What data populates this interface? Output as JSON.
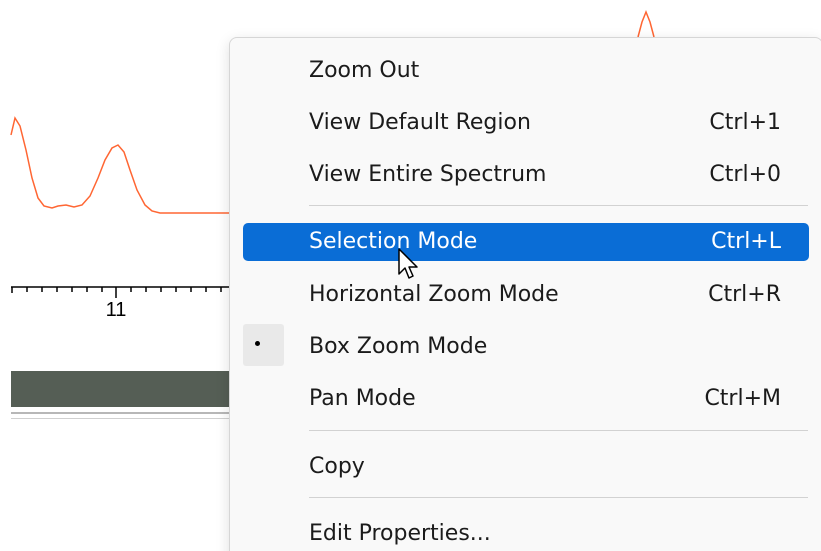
{
  "plot": {
    "trace_color": "#ff6633",
    "axis_tick_label": "11",
    "scrollbar_color": "#555e55"
  },
  "context_menu": {
    "highlight_color": "#0a6dd6",
    "items": [
      {
        "label": "Zoom Out",
        "shortcut": ""
      },
      {
        "label": "View Default Region",
        "shortcut": "Ctrl+1"
      },
      {
        "label": "View Entire Spectrum",
        "shortcut": "Ctrl+0"
      },
      {
        "label": "Selection Mode",
        "shortcut": "Ctrl+L",
        "highlighted": true
      },
      {
        "label": "Horizontal Zoom Mode",
        "shortcut": "Ctrl+R"
      },
      {
        "label": "Box Zoom Mode",
        "shortcut": "",
        "checked": true
      },
      {
        "label": "Pan Mode",
        "shortcut": "Ctrl+M"
      },
      {
        "label": "Copy",
        "shortcut": ""
      },
      {
        "label": "Edit Properties...",
        "shortcut": ""
      }
    ]
  },
  "cursor": {
    "icon": "arrow-cursor-icon"
  }
}
